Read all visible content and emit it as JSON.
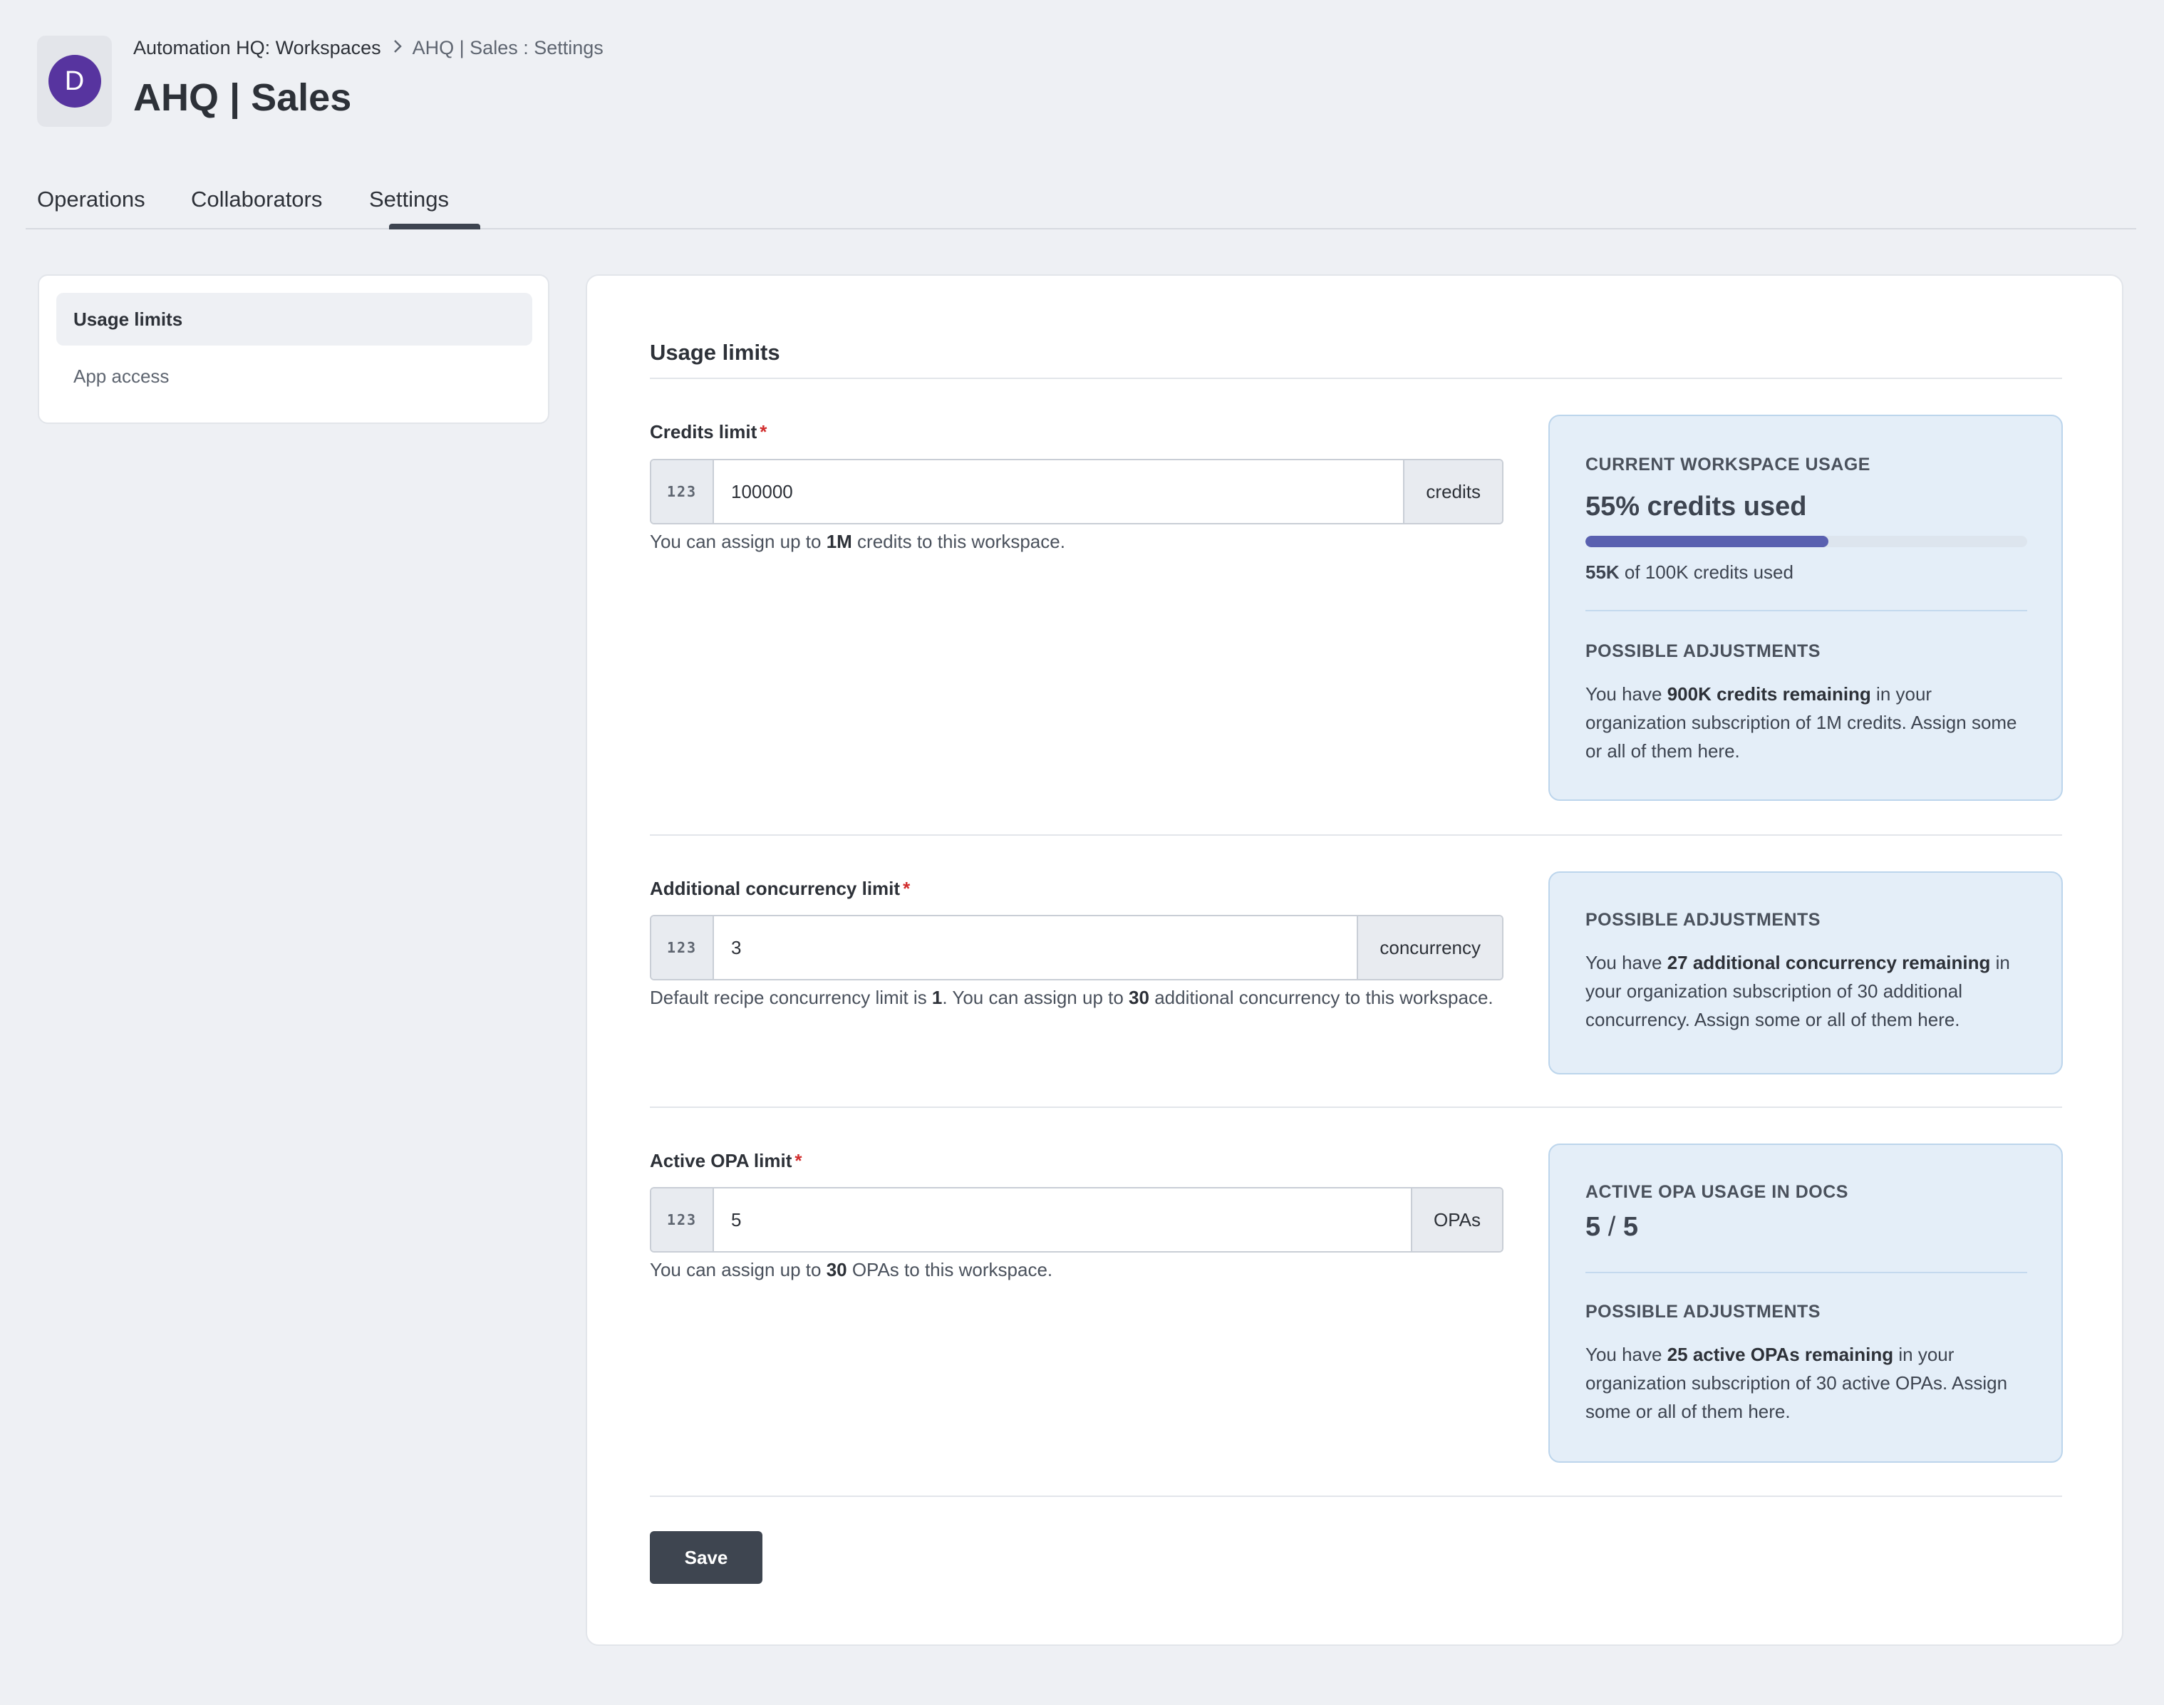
{
  "header": {
    "logo_letter": "D",
    "breadcrumb": {
      "parent": "Automation HQ: Workspaces",
      "current": "AHQ | Sales : Settings"
    },
    "title": "AHQ | Sales"
  },
  "tabs": [
    {
      "label": "Operations"
    },
    {
      "label": "Collaborators"
    },
    {
      "label": "Settings",
      "active": true
    }
  ],
  "sidebar": {
    "items": [
      {
        "label": "Usage limits",
        "active": true
      },
      {
        "label": "App access"
      }
    ]
  },
  "main": {
    "section_title": "Usage limits",
    "credits": {
      "label": "Credits limit",
      "required": "*",
      "prefix": "123",
      "value": "100000",
      "suffix": "credits",
      "help": {
        "pre": "You can assign up to ",
        "bold": "1M",
        "post": " credits to this workspace."
      },
      "usage_panel": {
        "heading": "CURRENT WORKSPACE USAGE",
        "percent_text": "55% credits used",
        "progress_fraction": 0.55,
        "used_bold": "55K",
        "used_rest": " of 100K credits used"
      },
      "adjust_panel": {
        "heading": "POSSIBLE ADJUSTMENTS",
        "pre": "You have ",
        "bold": "900K credits remaining",
        "post": " in your organization subscription of 1M credits. Assign some or all of them here."
      }
    },
    "concurrency": {
      "label": "Additional concurrency limit",
      "required": "*",
      "prefix": "123",
      "value": "3",
      "suffix": "concurrency",
      "help": {
        "p1": "Default recipe concurrency limit is ",
        "b1": "1",
        "p2": ". You can assign up to ",
        "b2": "30",
        "p3": " additional concurrency to this workspace."
      },
      "adjust_panel": {
        "heading": "POSSIBLE ADJUSTMENTS",
        "pre": "You have ",
        "bold": "27 additional concurrency remaining",
        "post": " in your organization subscription of 30 additional concurrency. Assign some or all of them here."
      }
    },
    "opa": {
      "label": "Active OPA limit",
      "required": "*",
      "prefix": "123",
      "value": "5",
      "suffix": "OPAs",
      "help": {
        "pre": "You can assign up to ",
        "bold": "30",
        "post": " OPAs to this workspace."
      },
      "usage_panel": {
        "heading": "ACTIVE OPA USAGE IN DOCS",
        "used": "5",
        "sep": " / ",
        "total": "5"
      },
      "adjust_panel": {
        "heading": "POSSIBLE ADJUSTMENTS",
        "pre": "You have ",
        "bold": "25 active OPAs remaining",
        "post": " in your organization subscription of 30 active OPAs. Assign some or all of them here."
      }
    },
    "save_label": "Save"
  },
  "colors": {
    "logo": "#57349f",
    "progress": "#5960b0",
    "panel_bg": "#e4eef8",
    "save_button": "#3e4550",
    "required": "#d12d2d"
  }
}
